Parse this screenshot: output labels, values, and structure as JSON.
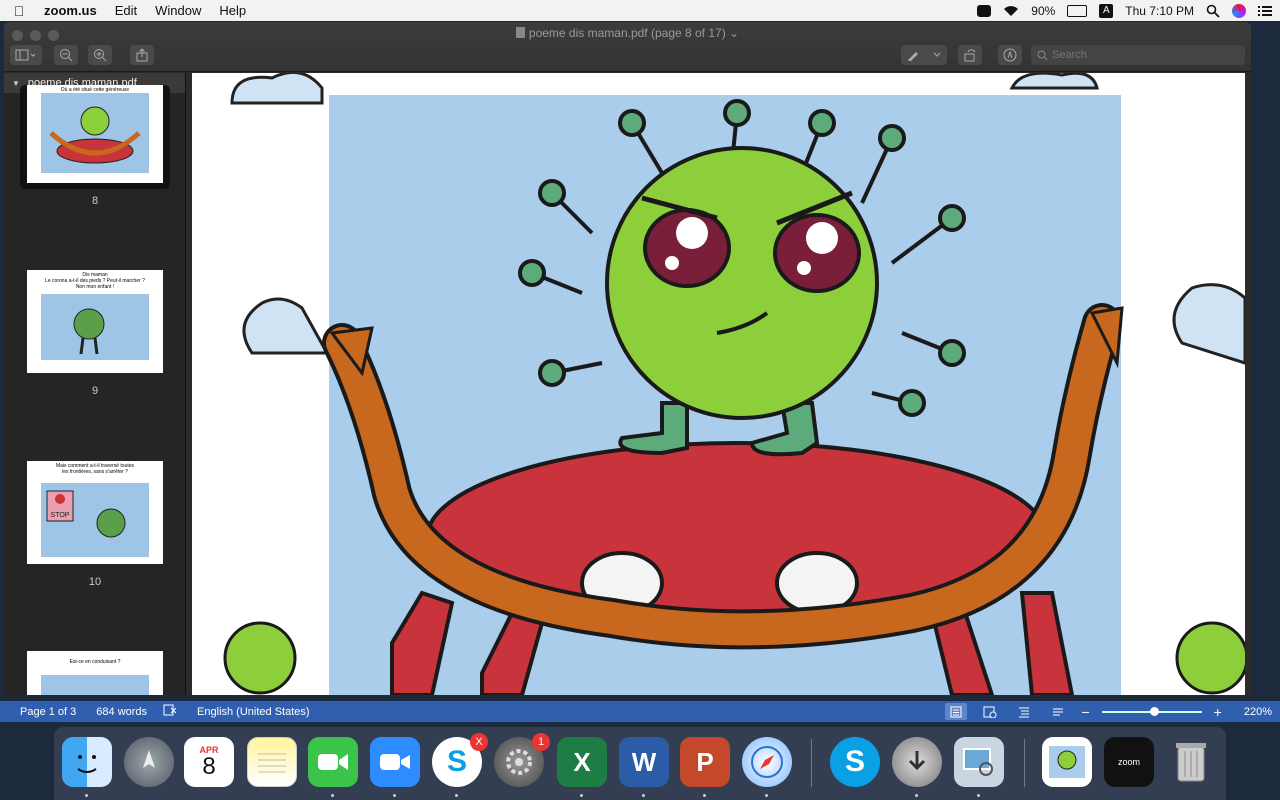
{
  "menubar": {
    "app_name": "zoom.us",
    "menus": [
      "Edit",
      "Window",
      "Help"
    ],
    "battery": "90%",
    "input_source": "A",
    "clock": "Thu 7:10 PM"
  },
  "window": {
    "title": "poeme dis maman.pdf (page 8 of 17)",
    "search_placeholder": "Search"
  },
  "sidebar": {
    "header": "poeme dis maman.pdf",
    "thumbnails": [
      {
        "page": "8",
        "caption": "Où a été situé cette généreuse"
      },
      {
        "page": "9",
        "caption": "Dis maman\nLe corona a-t-il des pieds ? Peut-il marcher ?\nNon mon enfant !"
      },
      {
        "page": "10",
        "caption": "Mais comment a-t-il traversé toutes\nles frontières, sans s'arrêter ?"
      },
      {
        "page": "",
        "caption": "Est-ce en conduisant ?"
      }
    ],
    "stop_sign": "STOP"
  },
  "statusbar": {
    "page": "Page 1 of 3",
    "words": "684 words",
    "language": "English (United States)",
    "zoom": "220%",
    "zoom_level": 0.52
  },
  "dock": {
    "calendar_month": "APR",
    "calendar_day": "8",
    "skype_badge": "X",
    "settings_badge": "1",
    "excel_letter": "X",
    "word_letter": "W",
    "powerpoint_letter": "P",
    "skype_letter": "S",
    "zoom_label": "zoom"
  }
}
